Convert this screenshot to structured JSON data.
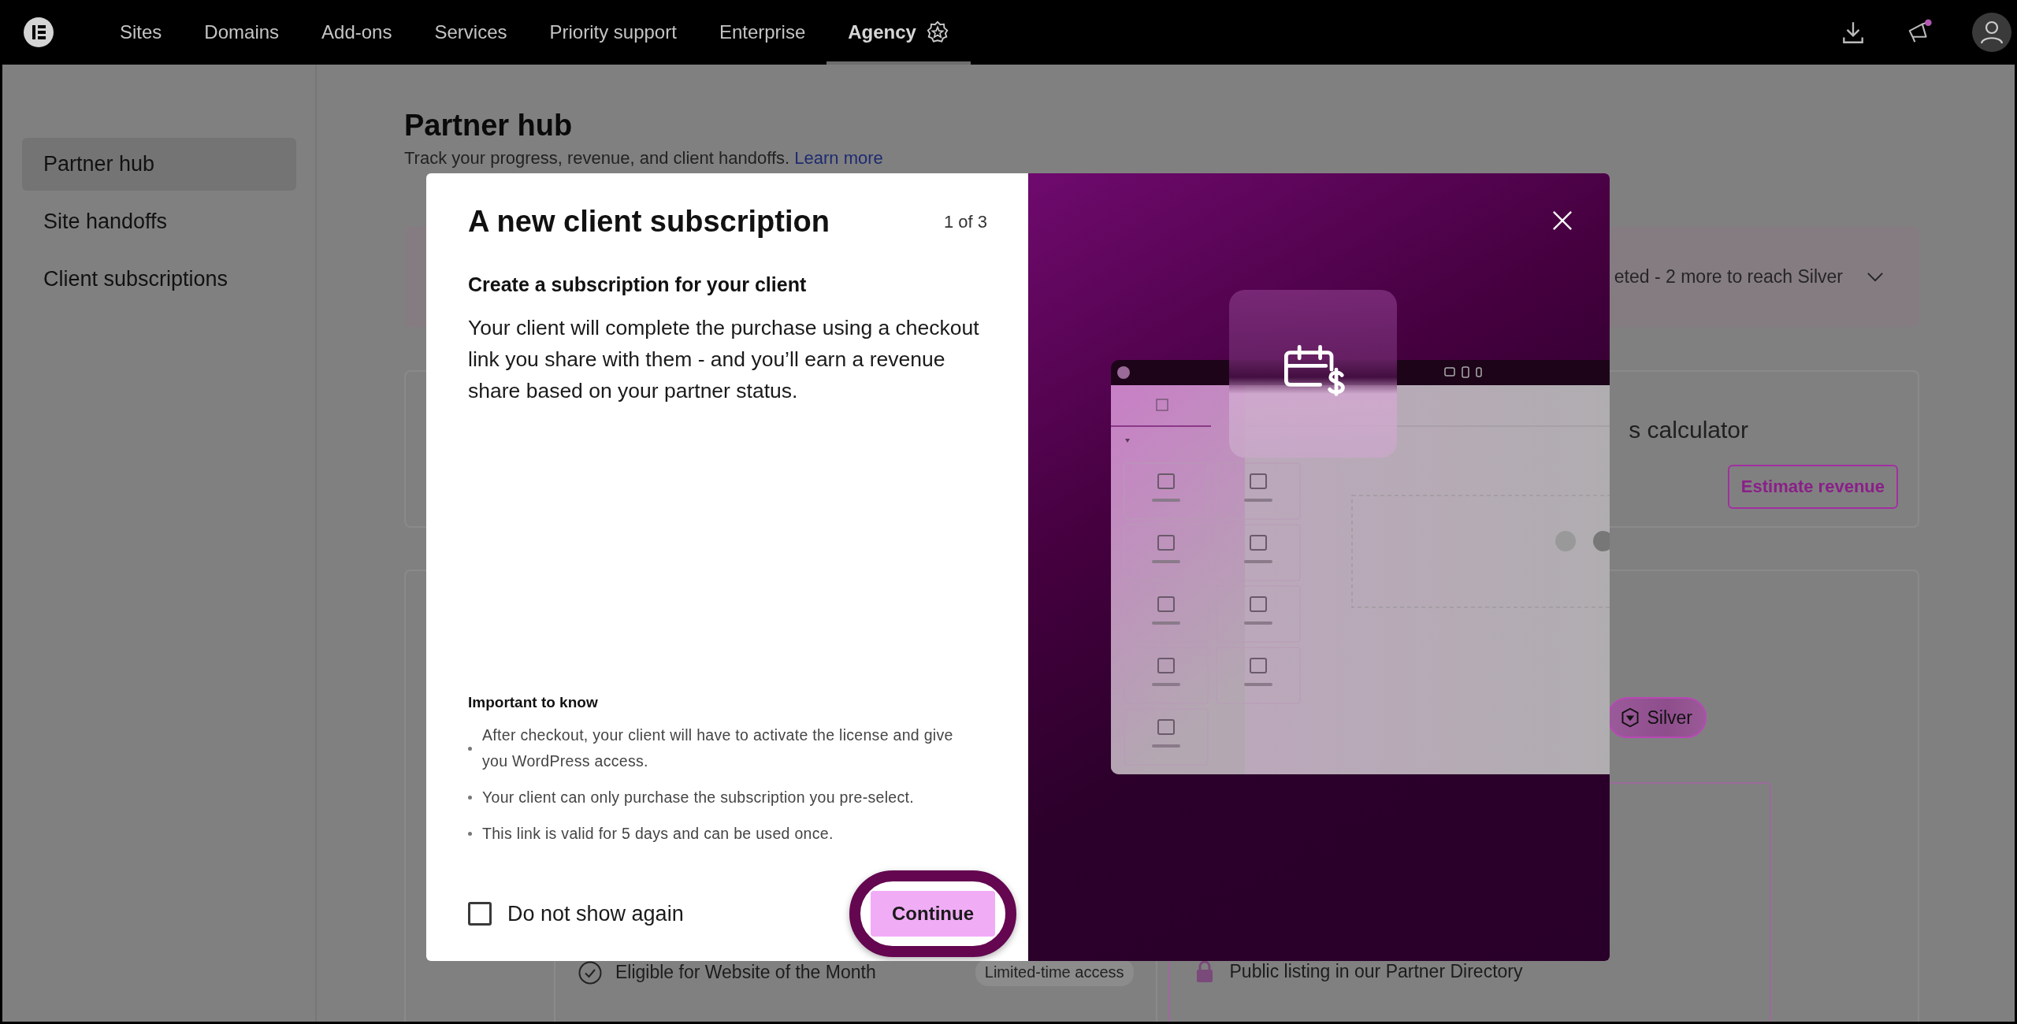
{
  "nav": {
    "items": [
      {
        "label": "Sites",
        "selected": false,
        "badge": false
      },
      {
        "label": "Domains",
        "selected": false,
        "badge": false
      },
      {
        "label": "Add-ons",
        "selected": false,
        "badge": false
      },
      {
        "label": "Services",
        "selected": false,
        "badge": false
      },
      {
        "label": "Priority support",
        "selected": false,
        "badge": false
      },
      {
        "label": "Enterprise",
        "selected": false,
        "badge": false
      },
      {
        "label": "Agency",
        "selected": true,
        "badge": true
      }
    ],
    "has_notification": true
  },
  "sidebar": {
    "items": [
      {
        "label": "Partner hub",
        "selected": true
      },
      {
        "label": "Site handoffs",
        "selected": false
      },
      {
        "label": "Client subscriptions",
        "selected": false
      }
    ]
  },
  "page": {
    "title": "Partner hub",
    "subtitle": "Track your progress, revenue, and client handoffs.",
    "subtitle_link": "Learn more",
    "progress_banner": {
      "text": "eted - 2 more to reach Silver",
      "expanded": false
    },
    "calculator_card": {
      "title": "s calculator",
      "button": "Estimate revenue"
    },
    "tier_badge": "Silver",
    "benefits": [
      {
        "kind": "check",
        "text": "Eligible for Website of the Month",
        "tag": "Limited-time access"
      },
      {
        "kind": "lock",
        "text": "Public listing in our Partner Directory"
      }
    ]
  },
  "modal": {
    "title": "A new client subscription",
    "step": "1 of 3",
    "heading": "Create a subscription for your client",
    "body": "Your client will complete the purchase using a checkout link you share with them - and you’ll earn a revenue share based on your partner status.",
    "important_title": "Important to know",
    "important_items": [
      "After checkout, your client will have to activate the license and give you WordPress access.",
      "Your client can only purchase the subscription you pre-select.",
      "This link is valid for 5 days and can be used once."
    ],
    "checkbox": {
      "label": "Do not show again",
      "checked": false
    },
    "primary_button": "Continue"
  }
}
